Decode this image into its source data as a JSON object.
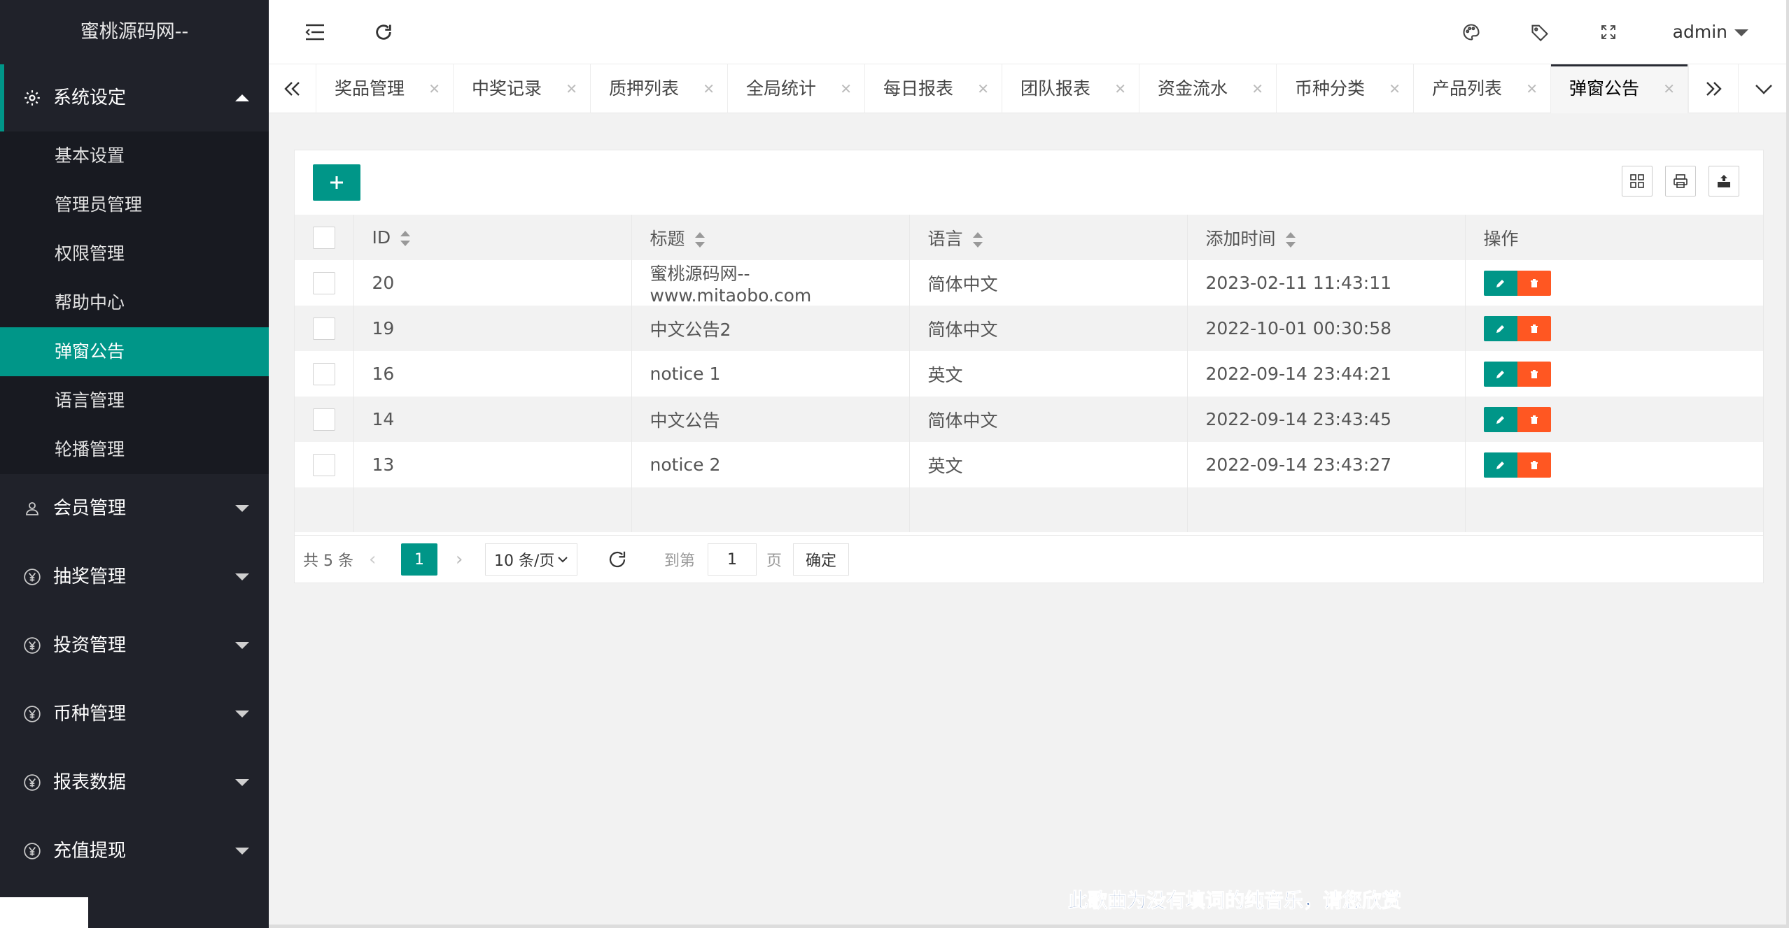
{
  "colors": {
    "sidebar": "#20222a",
    "accent": "#009688",
    "danger": "#ff5722"
  },
  "sidebar": {
    "logo": "蜜桃源码网--",
    "open_group": {
      "label": "系统设定",
      "icon": "gear-icon"
    },
    "sub_items": [
      "基本设置",
      "管理员管理",
      "权限管理",
      "帮助中心",
      "弹窗公告",
      "语言管理",
      "轮播管理"
    ],
    "active_sub": "弹窗公告",
    "groups": [
      {
        "label": "会员管理",
        "icon": "user-icon"
      },
      {
        "label": "抽奖管理",
        "icon": "yen-icon"
      },
      {
        "label": "投资管理",
        "icon": "yen-icon"
      },
      {
        "label": "币种管理",
        "icon": "yen-icon"
      },
      {
        "label": "报表数据",
        "icon": "yen-icon"
      },
      {
        "label": "充值提现",
        "icon": "yen-icon"
      }
    ]
  },
  "header": {
    "user": "admin"
  },
  "tabs": [
    "奖品管理",
    "中奖记录",
    "质押列表",
    "全局统计",
    "每日报表",
    "团队报表",
    "资金流水",
    "币种分类",
    "产品列表",
    "弹窗公告"
  ],
  "active_tab": "弹窗公告",
  "table": {
    "headers": {
      "id": "ID",
      "title": "标题",
      "lang": "语言",
      "time": "添加时间",
      "ops": "操作"
    },
    "rows": [
      {
        "id": "20",
        "title": "蜜桃源码网--www.mitaobo.com",
        "lang": "简体中文",
        "time": "2023-02-11 11:43:11"
      },
      {
        "id": "19",
        "title": "中文公告2",
        "lang": "简体中文",
        "time": "2022-10-01 00:30:58"
      },
      {
        "id": "16",
        "title": "notice 1",
        "lang": "英文",
        "time": "2022-09-14 23:44:21"
      },
      {
        "id": "14",
        "title": "中文公告",
        "lang": "简体中文",
        "time": "2022-09-14 23:43:45"
      },
      {
        "id": "13",
        "title": "notice 2",
        "lang": "英文",
        "time": "2022-09-14 23:43:27"
      }
    ]
  },
  "pager": {
    "total": "共 5 条",
    "current": "1",
    "per_page": "10 条/页",
    "goto_label": "到第",
    "goto_value": "1",
    "page_unit": "页",
    "confirm": "确定"
  },
  "overlay_caption": "此歌曲为没有填词的纯音乐，请您欣赏"
}
